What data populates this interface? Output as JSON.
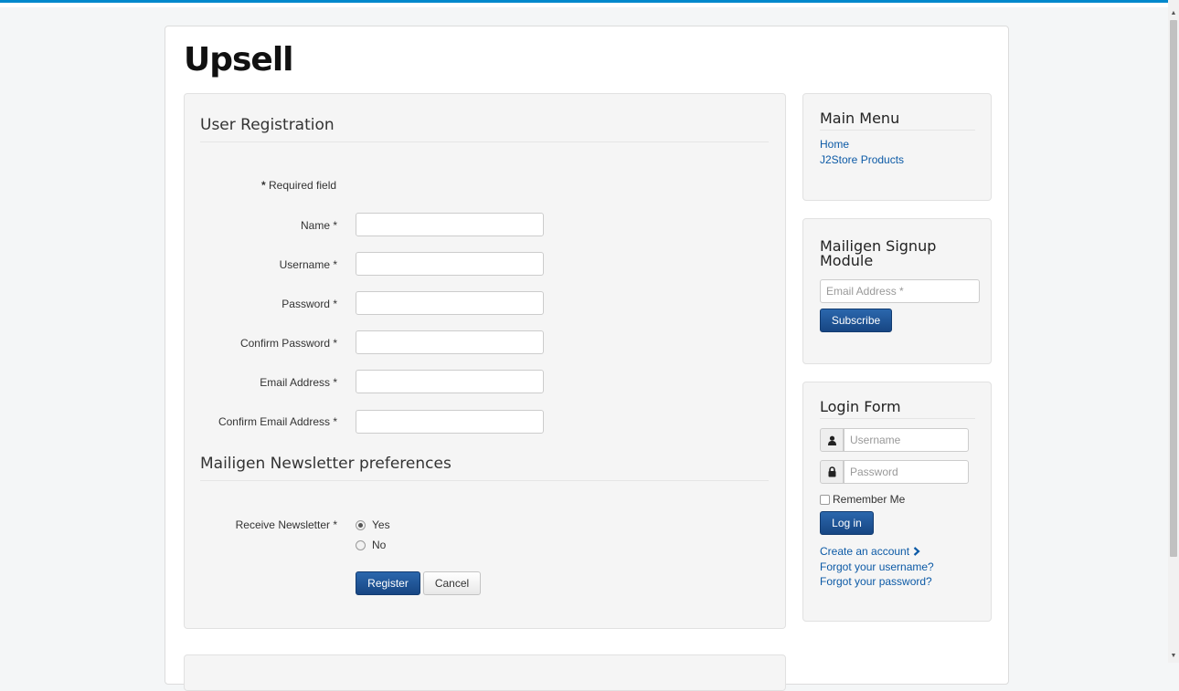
{
  "site": {
    "title": "Upsell"
  },
  "registration": {
    "title": "User Registration",
    "required_star": "*",
    "required_note": " Required field",
    "fields": [
      {
        "label": "Name *",
        "value": ""
      },
      {
        "label": "Username *",
        "value": ""
      },
      {
        "label": "Password *",
        "value": ""
      },
      {
        "label": "Confirm Password *",
        "value": ""
      },
      {
        "label": "Email Address *",
        "value": ""
      },
      {
        "label": "Confirm Email Address *",
        "value": ""
      }
    ],
    "newsletter_title": "Mailigen Newsletter preferences",
    "newsletter_label": "Receive Newsletter *",
    "newsletter_options": [
      {
        "label": "Yes",
        "selected": true
      },
      {
        "label": "No",
        "selected": false
      }
    ],
    "register_label": "Register",
    "cancel_label": "Cancel"
  },
  "main_menu": {
    "title": "Main Menu",
    "items": [
      "Home",
      "J2Store Products"
    ]
  },
  "signup": {
    "title_line1": "Mailigen Signup",
    "title_line2": "Module",
    "email_placeholder": "Email Address *",
    "subscribe_label": "Subscribe"
  },
  "login": {
    "title": "Login Form",
    "username_placeholder": "Username",
    "password_placeholder": "Password",
    "remember_label": "Remember Me",
    "login_label": "Log in",
    "create_account": "Create an account",
    "forgot_username": "Forgot your username?",
    "forgot_password": "Forgot your password?"
  },
  "colors": {
    "accent": "#0088cc",
    "primary_button": "#174683",
    "link": "#0c5aa6"
  }
}
